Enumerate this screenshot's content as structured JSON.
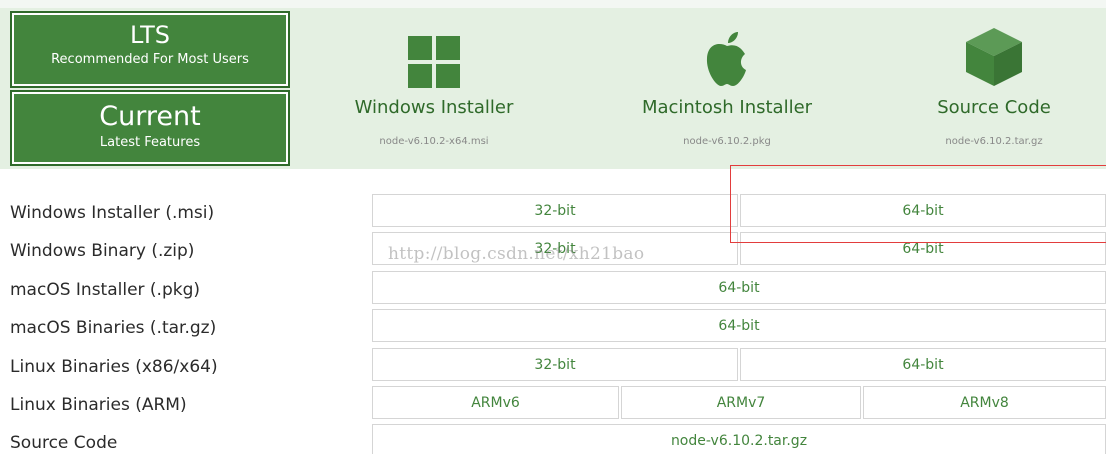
{
  "tabs": {
    "lts": {
      "title": "LTS",
      "subtitle": "Recommended For Most Users"
    },
    "current": {
      "title": "Current",
      "subtitle": "Latest Features"
    }
  },
  "downloads": {
    "windows": {
      "title": "Windows Installer",
      "file": "node-v6.10.2-x64.msi",
      "icon": "windows-logo-icon"
    },
    "mac": {
      "title": "Macintosh Installer",
      "file": "node-v6.10.2.pkg",
      "icon": "apple-logo-icon"
    },
    "source": {
      "title": "Source Code",
      "file": "node-v6.10.2.tar.gz",
      "icon": "box-icon"
    }
  },
  "table": {
    "rows": [
      {
        "label": "Windows Installer (.msi)",
        "cells": [
          "32-bit",
          "64-bit"
        ]
      },
      {
        "label": "Windows Binary (.zip)",
        "cells": [
          "32-bit",
          "64-bit"
        ]
      },
      {
        "label": "macOS Installer (.pkg)",
        "cells": [
          "64-bit"
        ]
      },
      {
        "label": "macOS Binaries (.tar.gz)",
        "cells": [
          "64-bit"
        ]
      },
      {
        "label": "Linux Binaries (x86/x64)",
        "cells": [
          "32-bit",
          "64-bit"
        ]
      },
      {
        "label": "Linux Binaries (ARM)",
        "cells": [
          "ARMv6",
          "ARMv7",
          "ARMv8"
        ]
      },
      {
        "label": "Source Code",
        "cells": [
          "node-v6.10.2.tar.gz"
        ]
      }
    ]
  },
  "watermark": "http://blog.csdn.net/xh21bao",
  "colors": {
    "brand_green": "#43853d",
    "banner_bg": "#e4f0e2",
    "highlight_red": "#e23d3d"
  }
}
